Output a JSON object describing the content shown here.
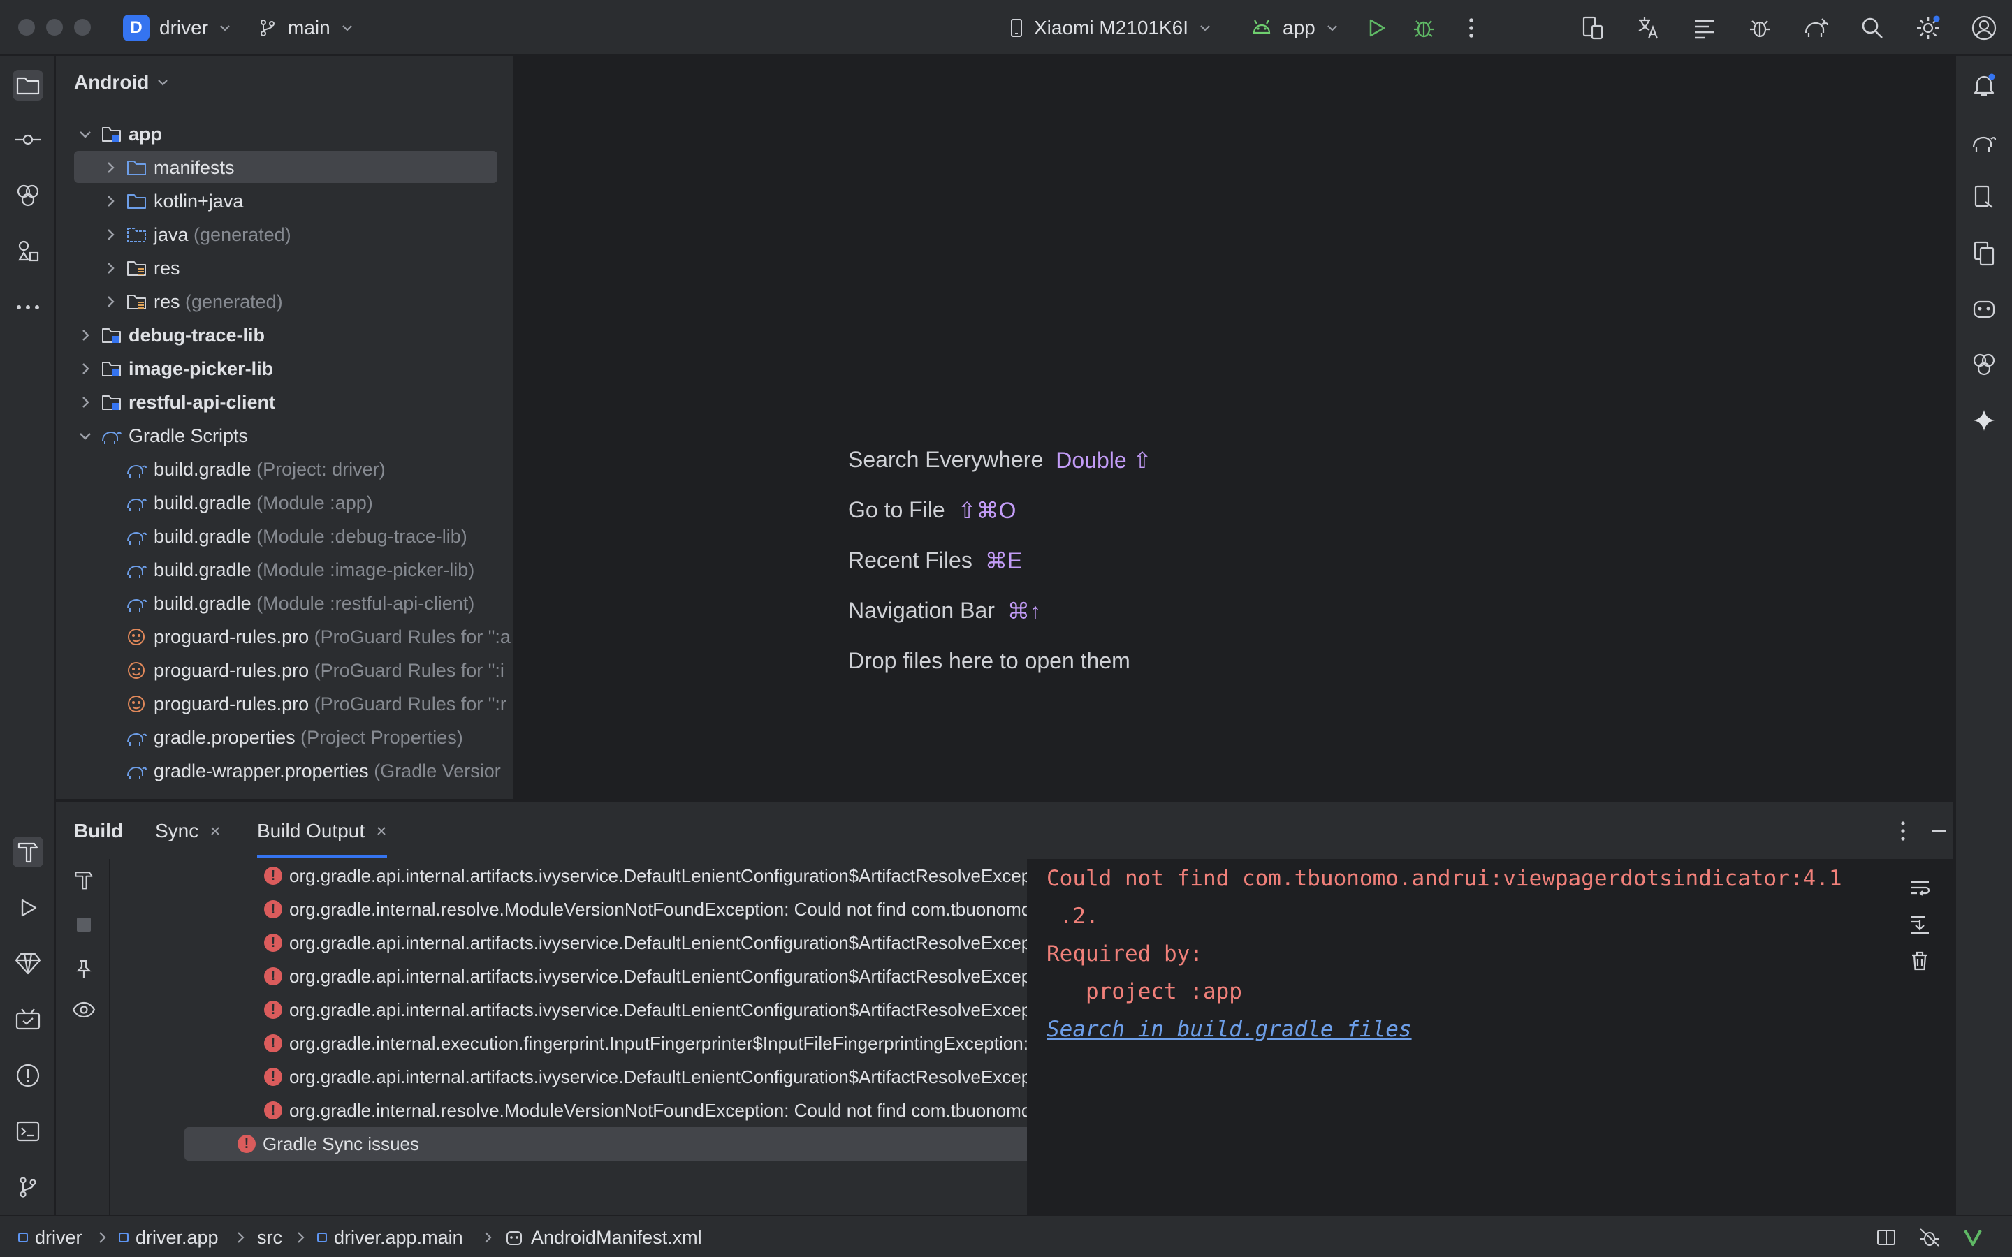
{
  "titlebar": {
    "project_initial": "D",
    "project_name": "driver",
    "branch": "main",
    "device": "Xiaomi M2101K6I",
    "run_config": "app"
  },
  "project_panel": {
    "view_mode": "Android",
    "rows": [
      {
        "label": "app",
        "hint": ""
      },
      {
        "label": "manifests",
        "hint": ""
      },
      {
        "label": "kotlin+java",
        "hint": ""
      },
      {
        "label": "java",
        "hint": "(generated)"
      },
      {
        "label": "res",
        "hint": ""
      },
      {
        "label": "res",
        "hint": "(generated)"
      },
      {
        "label": "debug-trace-lib",
        "hint": ""
      },
      {
        "label": "image-picker-lib",
        "hint": ""
      },
      {
        "label": "restful-api-client",
        "hint": ""
      },
      {
        "label": "Gradle Scripts",
        "hint": ""
      },
      {
        "label": "build.gradle",
        "hint": "(Project: driver)"
      },
      {
        "label": "build.gradle",
        "hint": "(Module :app)"
      },
      {
        "label": "build.gradle",
        "hint": "(Module :debug-trace-lib)"
      },
      {
        "label": "build.gradle",
        "hint": "(Module :image-picker-lib)"
      },
      {
        "label": "build.gradle",
        "hint": "(Module :restful-api-client)"
      },
      {
        "label": "proguard-rules.pro",
        "hint": "(ProGuard Rules for \":a"
      },
      {
        "label": "proguard-rules.pro",
        "hint": "(ProGuard Rules for \":i"
      },
      {
        "label": "proguard-rules.pro",
        "hint": "(ProGuard Rules for \":r"
      },
      {
        "label": "gradle.properties",
        "hint": "(Project Properties)"
      },
      {
        "label": "gradle-wrapper.properties",
        "hint": "(Gradle Versior"
      }
    ]
  },
  "editor_tips": [
    {
      "label": "Search Everywhere",
      "key": "Double ⇧"
    },
    {
      "label": "Go to File",
      "key": "⇧⌘O"
    },
    {
      "label": "Recent Files",
      "key": "⌘E"
    },
    {
      "label": "Navigation Bar",
      "key": "⌘↑"
    },
    {
      "label": "Drop files here to open them",
      "key": ""
    }
  ],
  "build": {
    "tabs": [
      "Build",
      "Sync",
      "Build Output"
    ],
    "issues": [
      "org.gradle.api.internal.artifacts.ivyservice.DefaultLenientConfiguration$ArtifactResolveExcep",
      "org.gradle.internal.resolve.ModuleVersionNotFoundException: Could not find com.tbuonomo",
      "org.gradle.api.internal.artifacts.ivyservice.DefaultLenientConfiguration$ArtifactResolveExcep",
      "org.gradle.api.internal.artifacts.ivyservice.DefaultLenientConfiguration$ArtifactResolveExcep",
      "org.gradle.api.internal.artifacts.ivyservice.DefaultLenientConfiguration$ArtifactResolveExcep",
      "org.gradle.internal.execution.fingerprint.InputFingerprinter$InputFileFingerprintingException:",
      "org.gradle.api.internal.artifacts.ivyservice.DefaultLenientConfiguration$ArtifactResolveExcep",
      "org.gradle.internal.resolve.ModuleVersionNotFoundException: Could not find com.tbuonomo"
    ],
    "sync_issues_label": "Gradle Sync issues",
    "console": {
      "line1": "Could not find com.tbuonomo.andrui:viewpagerdotsindicator:4.1",
      "line2": ".2.",
      "line3": "Required by:",
      "line4": "project :app",
      "link": "Search in build.gradle files"
    }
  },
  "statusbar": {
    "crumbs": [
      "driver",
      "driver.app",
      "src",
      "driver.app.main",
      "AndroidManifest.xml"
    ]
  },
  "colors": {
    "accent": "#3574f0",
    "error": "#db5c5c",
    "shortcut": "#c39cf7",
    "link": "#6d9ee8"
  }
}
